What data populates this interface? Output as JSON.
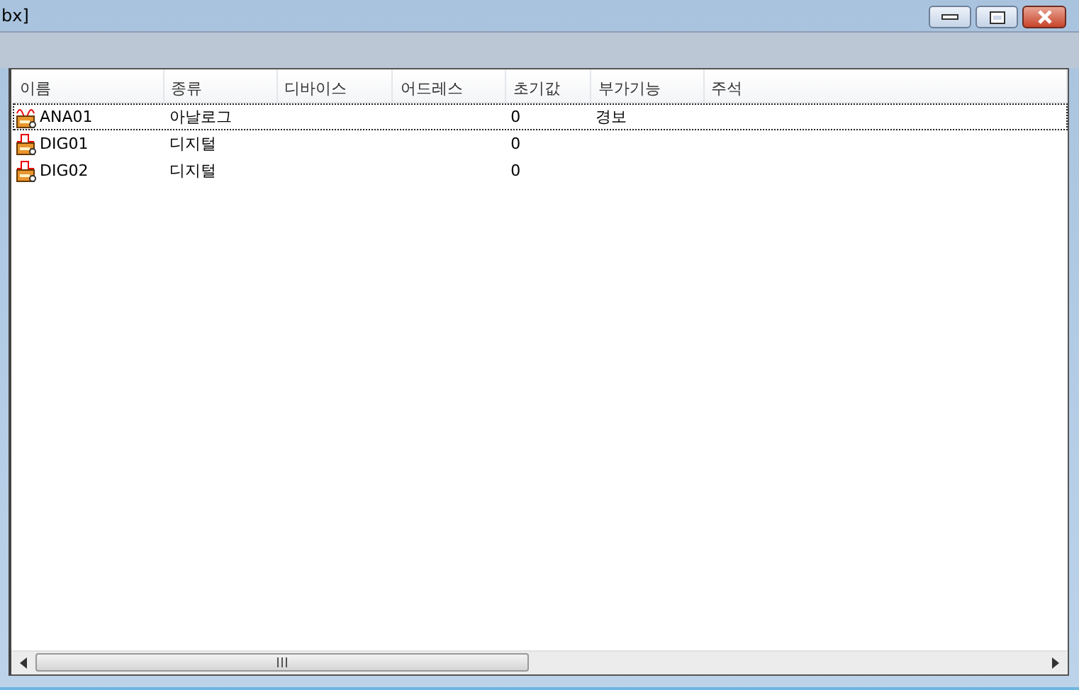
{
  "window": {
    "title": "bx]"
  },
  "table": {
    "columns": [
      "이름",
      "종류",
      "디바이스",
      "어드레스",
      "초기값",
      "부가기능",
      "주석"
    ],
    "rows": [
      {
        "kind": "analog",
        "selected": true,
        "cells": [
          "ANA01",
          "아날로그",
          "",
          "",
          "0",
          "경보",
          ""
        ]
      },
      {
        "kind": "digital",
        "selected": false,
        "cells": [
          "DIG01",
          "디지털",
          "",
          "",
          "0",
          "",
          ""
        ]
      },
      {
        "kind": "digital",
        "selected": false,
        "cells": [
          "DIG02",
          "디지털",
          "",
          "",
          "0",
          "",
          ""
        ]
      }
    ]
  }
}
